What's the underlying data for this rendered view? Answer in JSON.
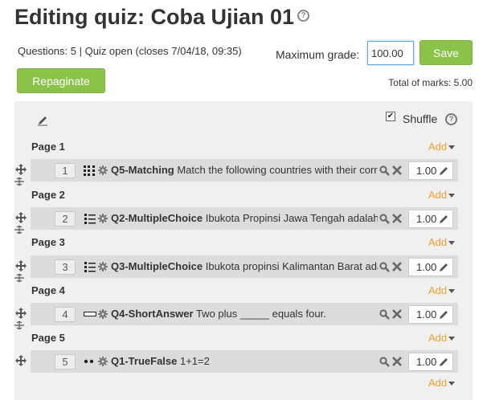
{
  "header": {
    "title": "Editing quiz: Coba Ujian 01",
    "help_icon": "question-circle-icon",
    "status": "Questions: 5 | Quiz open (closes 7/04/18, 09:35)",
    "max_grade_label": "Maximum grade:",
    "max_grade_value": "100.00",
    "save_label": "Save",
    "repaginate_label": "Repaginate",
    "total_marks": "Total of marks: 5.00"
  },
  "toolbar": {
    "shuffle_label": "Shuffle",
    "shuffle_checked": true,
    "shuffle_check_glyph": "✔"
  },
  "add_label": "Add",
  "colors": {
    "accent_green": "#8bc34a",
    "add_link": "#f0a030",
    "row_bg": "#dcdcdc",
    "panel_bg": "#f0f0f0"
  },
  "pages": [
    {
      "label": "Page 1",
      "question": {
        "number": "1",
        "type_icon": "matching-icon",
        "name": "Q5-Matching",
        "text": " Match the following countries with their corresponding capitals.",
        "mark": "1.00"
      }
    },
    {
      "label": "Page 2",
      "question": {
        "number": "2",
        "type_icon": "multichoice-icon",
        "name": "Q2-MultipleChoice",
        "text": " Ibukota Propinsi Jawa Tengah adalah",
        "mark": "1.00"
      }
    },
    {
      "label": "Page 3",
      "question": {
        "number": "3",
        "type_icon": "multichoice-icon",
        "name": "Q3-MultipleChoice",
        "text": " Ibukota propinsi Kalimantan Barat adalah",
        "mark": "1.00"
      }
    },
    {
      "label": "Page 4",
      "question": {
        "number": "4",
        "type_icon": "shortanswer-icon",
        "name": "Q4-ShortAnswer",
        "text": " Two plus _____ equals four.",
        "mark": "1.00"
      }
    },
    {
      "label": "Page 5",
      "question": {
        "number": "5",
        "type_icon": "truefalse-icon",
        "name": "Q1-TrueFalse",
        "text": " 1+1=2",
        "mark": "1.00"
      }
    }
  ]
}
